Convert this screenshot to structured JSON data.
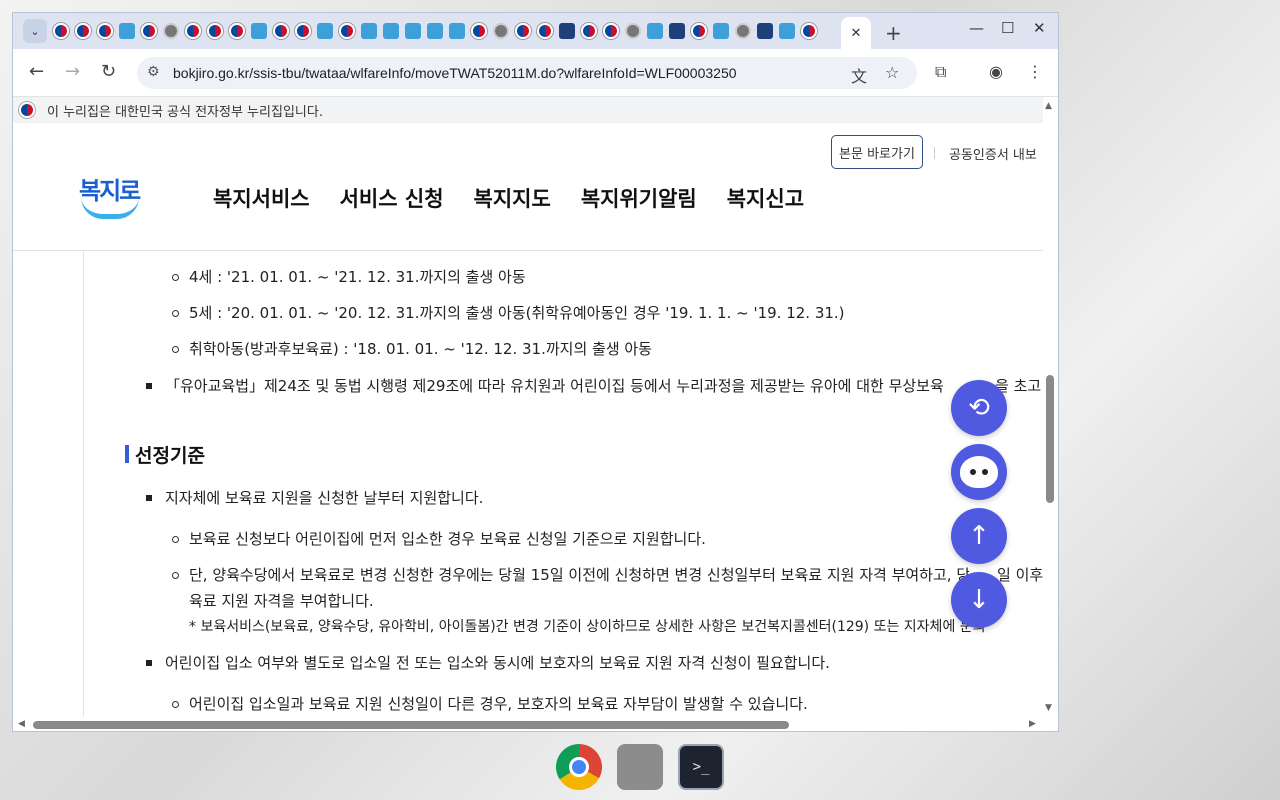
{
  "browser": {
    "active_tab_close": "✕",
    "new_tab": "+",
    "url": "bokjiro.go.kr/ssis-tbu/twataa/wlfareInfo/moveTWAT52011M.do?wlfareInfoId=WLF00003250"
  },
  "gov_banner": "이 누리집은 대한민국 공식 전자정부 누리집입니다.",
  "header": {
    "skip_button": "본문 바로가기",
    "cert_link": "공동인증서 내보",
    "logo_text": "복지로",
    "nav": [
      "복지서비스",
      "서비스 신청",
      "복지지도",
      "복지위기알림",
      "복지신고"
    ]
  },
  "content": {
    "age_lines": [
      "4세 : '21. 01. 01. ~ '21. 12. 31.까지의 출생 아동",
      "5세 : '20. 01. 01. ~ '20. 12. 31.까지의 출생 아동(취학유예아동인 경우 '19. 1. 1. ~ '19. 12. 31.)",
      "취학아동(방과후보육료) : '18. 01. 01. ~ '12. 12. 31.까지의 출생 아동"
    ],
    "law_line": "「유아교육법」제24조 및 동법 시행령 제29조에 따라 유치원과 어린이집 등에서 누리과정을 제공받는 유아에 대한 무상보육 기간",
    "law_line_tail": "을 초고",
    "section_title": "선정기준",
    "criteria_1": "지자체에 보육료 지원을 신청한 날부터 지원합니다.",
    "criteria_1a": "보육료 신청보다 어린이집에 먼저 입소한 경우 보육료 신청일 기준으로 지원합니다.",
    "criteria_1b_line1": "단, 양육수당에서 보육료로 변경 신청한 경우에는 당월 15일 이전에 신청하면 변경 신청일부터 보육료 지원 자격 부여하고, 당",
    "criteria_1b_tail": "일 이후에",
    "criteria_1b_line2": "육료 지원 자격을 부여합니다.",
    "criteria_1b_note": "* 보육서비스(보육료, 양육수당, 유아학비, 아이돌봄)간 변경 기준이 상이하므로 상세한 사항은 보건복지콜센터(129) 또는 지자체에 문의",
    "criteria_2": "어린이집 입소 여부와 별도로 입소일 전 또는 입소와 동시에 보호자의 보육료 지원 자격 신청이 필요합니다.",
    "criteria_2a": "어린이집 입소일과 보육료 지원 신청일이 다른 경우, 보호자의 보육료 자부담이 발생할 수 있습니다."
  },
  "colors": {
    "fab": "#4f5ae0",
    "section_bar": "#2f5fd0",
    "logo_blue": "#1a5fd0"
  }
}
